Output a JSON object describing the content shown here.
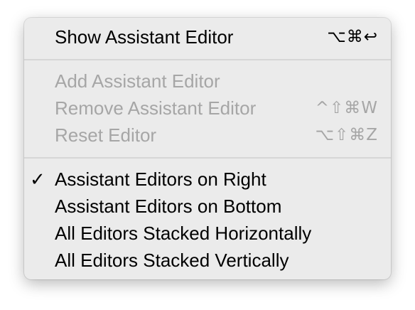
{
  "menu": {
    "items": [
      {
        "label": "Show Assistant Editor",
        "shortcut": "⌥⌘↩",
        "check": "",
        "enabled": true
      },
      {
        "label": "Add Assistant Editor",
        "shortcut": "",
        "check": "",
        "enabled": false
      },
      {
        "label": "Remove Assistant Editor",
        "shortcut": "^⇧⌘W",
        "check": "",
        "enabled": false
      },
      {
        "label": "Reset Editor",
        "shortcut": "⌥⇧⌘Z",
        "check": "",
        "enabled": false
      },
      {
        "label": "Assistant Editors on Right",
        "shortcut": "",
        "check": "✓",
        "enabled": true
      },
      {
        "label": "Assistant Editors on Bottom",
        "shortcut": "",
        "check": "",
        "enabled": true
      },
      {
        "label": "All Editors Stacked Horizontally",
        "shortcut": "",
        "check": "",
        "enabled": true
      },
      {
        "label": "All Editors Stacked Vertically",
        "shortcut": "",
        "check": "",
        "enabled": true
      }
    ]
  }
}
